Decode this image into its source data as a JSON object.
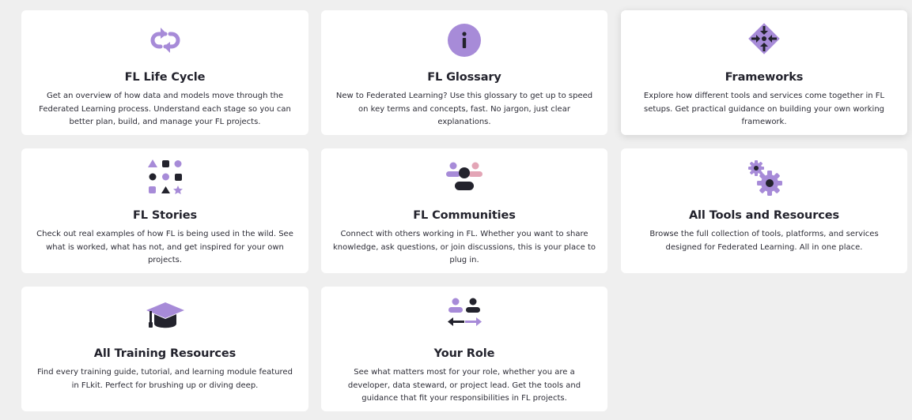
{
  "colors": {
    "accent": "#a78bd8",
    "dark": "#23232d",
    "pink": "#e3a5b6",
    "background": "#efefef",
    "card": "#ffffff"
  },
  "cards": [
    {
      "icon": "cycle-arrows-icon",
      "title": "FL Life Cycle",
      "description": "Get an overview of how data and models move through the Federated Learning process. Understand each stage so you can better plan, build, and manage your FL projects."
    },
    {
      "icon": "info-icon",
      "title": "FL Glossary",
      "description": "New to Federated Learning? Use this glossary to get up to speed on key terms and concepts, fast. No jargon, just clear explanations."
    },
    {
      "icon": "frameworks-icon",
      "title": "Frameworks",
      "description": "Explore how different tools and services come together in FL setups. Get practical guidance on building your own working framework."
    },
    {
      "icon": "shapes-grid-icon",
      "title": "FL Stories",
      "description": "Check out real examples of how FL is being used in the wild. See what is worked, what has not, and get inspired for your own projects."
    },
    {
      "icon": "community-icon",
      "title": "FL Communities",
      "description": "Connect with others working in FL. Whether you want to share knowledge, ask questions, or join discussions, this is your place to plug in."
    },
    {
      "icon": "gears-icon",
      "title": "All Tools and Resources",
      "description": "Browse the full collection of tools, platforms, and services designed for Federated Learning. All in one place."
    },
    {
      "icon": "graduation-cap-icon",
      "title": "All Training Resources",
      "description": "Find every training guide, tutorial, and learning module featured in FLkit. Perfect for brushing up or diving deep."
    },
    {
      "icon": "role-exchange-icon",
      "title": "Your Role",
      "description": "See what matters most for your role, whether you are a developer, data steward, or project lead. Get the tools and guidance that fit your responsibilities in FL projects."
    }
  ]
}
